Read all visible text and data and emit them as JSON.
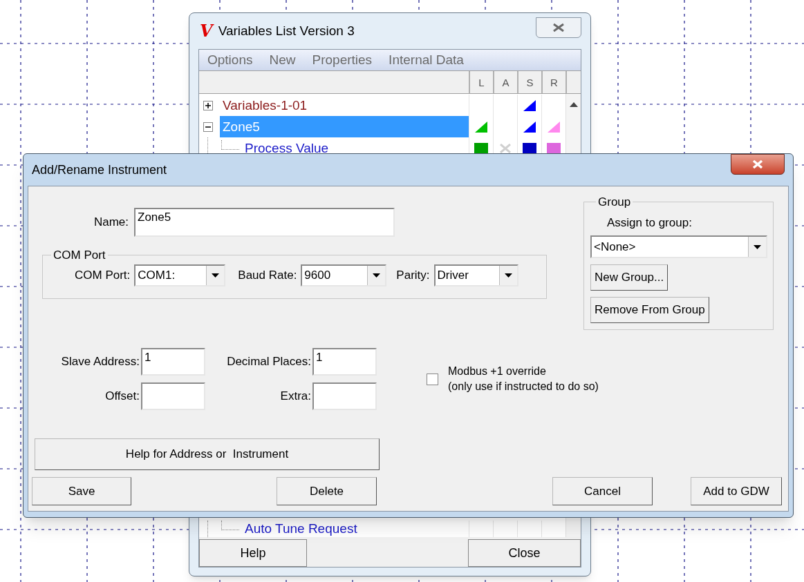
{
  "back_window": {
    "logo": "V",
    "title": "Variables List Version 3",
    "menu": [
      "Options",
      "New",
      "Properties",
      "Internal Data"
    ],
    "columns": [
      "L",
      "A",
      "S",
      "R"
    ],
    "tree": [
      {
        "label": "Variables-1-01",
        "color": "#8b1a1a",
        "expanded": false,
        "selected": false,
        "cells": [
          {
            "kind": "none"
          },
          {
            "kind": "none"
          },
          {
            "kind": "triangle",
            "color": "#0000ff"
          },
          {
            "kind": "none"
          }
        ]
      },
      {
        "label": "Zone5",
        "expanded": true,
        "selected": true,
        "cells": [
          {
            "kind": "triangle",
            "color": "#00c000"
          },
          {
            "kind": "none"
          },
          {
            "kind": "triangle",
            "color": "#0000ff"
          },
          {
            "kind": "triangle",
            "color": "#ff88ee"
          }
        ],
        "children": [
          {
            "label": "Process Value",
            "color": "#1a1ac8",
            "selected": false,
            "cells": [
              {
                "kind": "square",
                "color": "#00a000"
              },
              {
                "kind": "cross"
              },
              {
                "kind": "square",
                "color": "#0000c0"
              },
              {
                "kind": "square",
                "color": "#dd66dd"
              }
            ]
          },
          {
            "label": "Auto Tune Request",
            "color": "#1a1ac8",
            "selected": false,
            "cells": [
              {
                "kind": "none"
              },
              {
                "kind": "none"
              },
              {
                "kind": "none"
              },
              {
                "kind": "none"
              }
            ]
          }
        ]
      }
    ],
    "buttons": [
      "Help",
      "Close"
    ]
  },
  "dialog": {
    "title": "Add/Rename Instrument",
    "name": {
      "label": "Name:",
      "value": "Zone5"
    },
    "com_port": {
      "title": "COM Port",
      "fields": [
        {
          "label": "COM Port:",
          "value": "COM1:"
        },
        {
          "label": "Baud Rate:",
          "value": "9600"
        },
        {
          "label": "Parity:",
          "value": "Driver"
        }
      ]
    },
    "group": {
      "title": "Group",
      "label": "Assign to group:",
      "value": "<None>",
      "buttons": [
        "New Group...",
        "Remove From Group"
      ]
    },
    "fields": [
      {
        "label": "Slave Address:",
        "value": "1"
      },
      {
        "label": "Decimal Places:",
        "value": "1"
      },
      {
        "label": "Offset:"
      },
      {
        "label": "Extra:"
      }
    ],
    "checkbox": {
      "label": "Modbus +1 override\n(only use if instructed to do so)",
      "checked": false
    },
    "help_button": "Help for Address or  Instrument",
    "buttons": [
      "Save",
      "Delete",
      "Cancel",
      "Add to GDW"
    ]
  }
}
